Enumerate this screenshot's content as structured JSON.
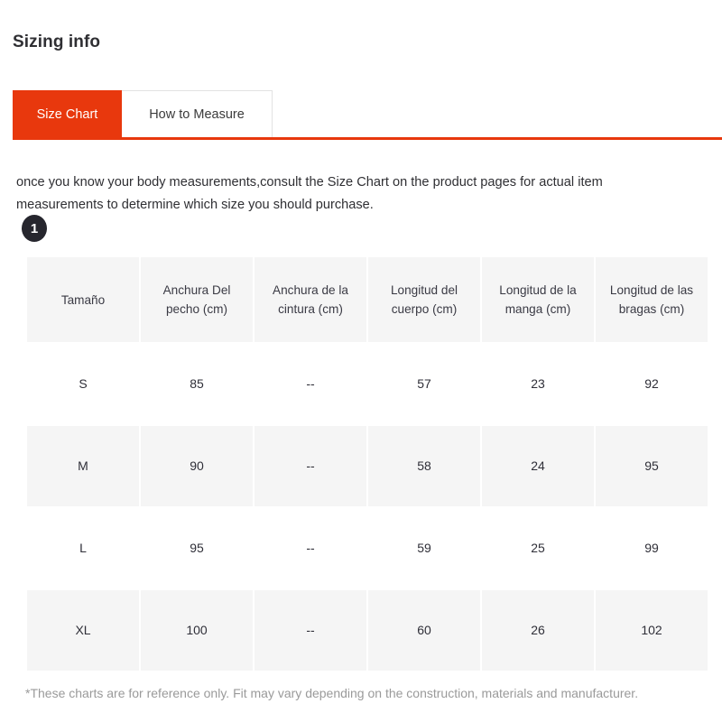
{
  "page": {
    "title": "Sizing info"
  },
  "tabs": [
    {
      "label": "Size Chart",
      "active": true
    },
    {
      "label": "How to Measure",
      "active": false
    }
  ],
  "intro": {
    "text": "once you know your body measurements,consult the Size Chart on the product pages for actual item measurements to determine which size you should purchase."
  },
  "step_badge": {
    "number": "1"
  },
  "chart_data": {
    "type": "table",
    "title": "Size Chart",
    "columns": [
      "Tamaño",
      "Anchura Del pecho (cm)",
      "Anchura de la cintura (cm)",
      "Longitud del cuerpo (cm)",
      "Longitud de la manga (cm)",
      "Longitud de las bragas (cm)"
    ],
    "rows": [
      [
        "S",
        "85",
        "--",
        "57",
        "23",
        "92"
      ],
      [
        "M",
        "90",
        "--",
        "58",
        "24",
        "95"
      ],
      [
        "L",
        "95",
        "--",
        "59",
        "25",
        "99"
      ],
      [
        "XL",
        "100",
        "--",
        "60",
        "26",
        "102"
      ]
    ]
  },
  "footnote": {
    "text": "*These charts are for reference only. Fit may vary depending on the construction, materials and manufacturer."
  },
  "colors": {
    "accent": "#e8380d",
    "header_cell": "#f5f5f5",
    "badge": "#26262e",
    "footnote_text": "#9a9a9a"
  }
}
